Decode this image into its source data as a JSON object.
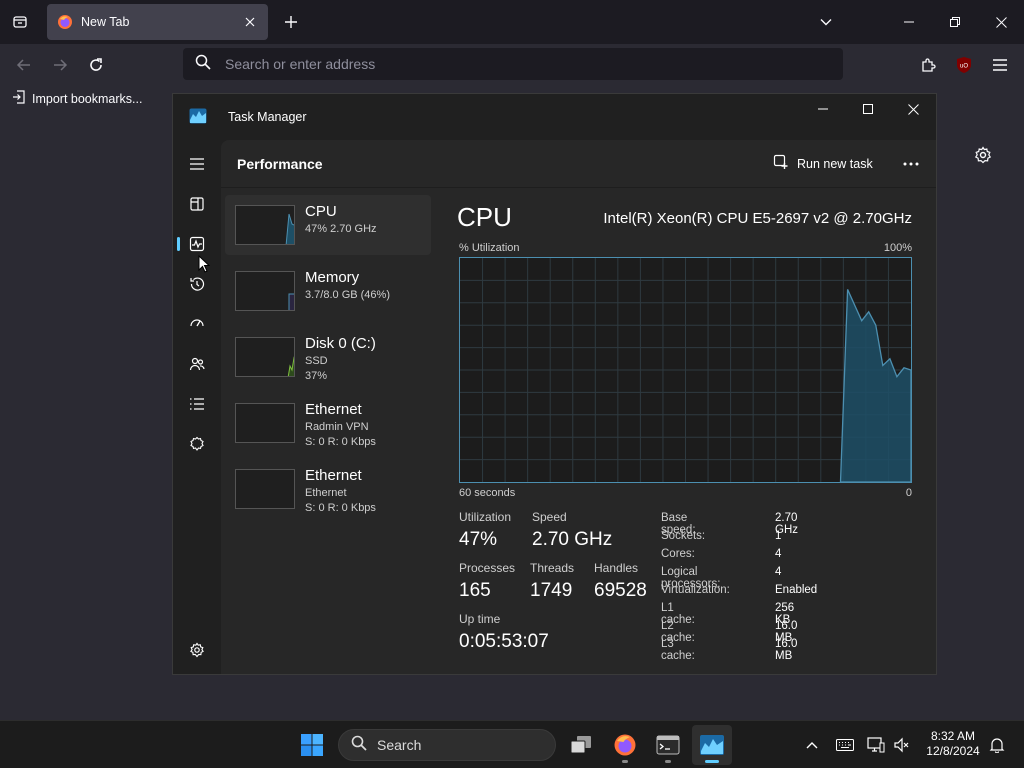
{
  "browser": {
    "tab_title": "New Tab",
    "address_placeholder": "Search or enter address",
    "bookmark_item": "Import bookmarks..."
  },
  "task_manager": {
    "window_title": "Task Manager",
    "page_title": "Performance",
    "run_new_task": "Run new task",
    "devices": [
      {
        "name": "CPU",
        "sub1": "47% 2.70 GHz",
        "sub2": ""
      },
      {
        "name": "Memory",
        "sub1": "3.7/8.0 GB (46%)",
        "sub2": ""
      },
      {
        "name": "Disk 0 (C:)",
        "sub1": "SSD",
        "sub2": "37%"
      },
      {
        "name": "Ethernet",
        "sub1": "Radmin VPN",
        "sub2": "S: 0 R: 0 Kbps"
      },
      {
        "name": "Ethernet",
        "sub1": "Ethernet",
        "sub2": "S: 0 R: 0 Kbps"
      }
    ],
    "detail": {
      "title": "CPU",
      "model": "Intel(R) Xeon(R) CPU E5-2697 v2 @ 2.70GHz",
      "y_label": "% Utilization",
      "y_max": "100%",
      "x_label": "60 seconds",
      "x_min": "0",
      "stats": {
        "utilization_label": "Utilization",
        "utilization": "47%",
        "speed_label": "Speed",
        "speed": "2.70 GHz",
        "processes_label": "Processes",
        "processes": "165",
        "threads_label": "Threads",
        "threads": "1749",
        "handles_label": "Handles",
        "handles": "69528",
        "uptime_label": "Up time",
        "uptime": "0:05:53:07"
      },
      "specs": [
        {
          "k": "Base speed:",
          "v": "2.70 GHz"
        },
        {
          "k": "Sockets:",
          "v": "1"
        },
        {
          "k": "Cores:",
          "v": "4"
        },
        {
          "k": "Logical processors:",
          "v": "4"
        },
        {
          "k": "Virtualization:",
          "v": "Enabled"
        },
        {
          "k": "L1 cache:",
          "v": "256 KB"
        },
        {
          "k": "L2 cache:",
          "v": "16.0 MB"
        },
        {
          "k": "L3 cache:",
          "v": "16.0 MB"
        }
      ],
      "graph_series_percent": [
        0,
        0,
        0,
        0,
        0,
        0,
        0,
        0,
        0,
        0,
        0,
        0,
        0,
        0,
        0,
        0,
        0,
        0,
        0,
        0,
        0,
        0,
        0,
        0,
        0,
        0,
        0,
        0,
        0,
        0,
        0,
        0,
        0,
        0,
        0,
        0,
        0,
        0,
        0,
        0,
        0,
        0,
        0,
        0,
        0,
        0,
        0,
        0,
        0,
        0,
        0,
        0,
        0,
        0,
        0,
        86,
        79,
        72,
        76,
        70,
        52,
        55,
        47,
        51,
        50
      ]
    }
  },
  "taskbar": {
    "search_label": "Search",
    "time": "8:32 AM",
    "date": "12/8/2024"
  },
  "colors": {
    "accent": "#60cdff",
    "graph_line": "#4c8fb0",
    "graph_fill": "#1d4f66"
  }
}
